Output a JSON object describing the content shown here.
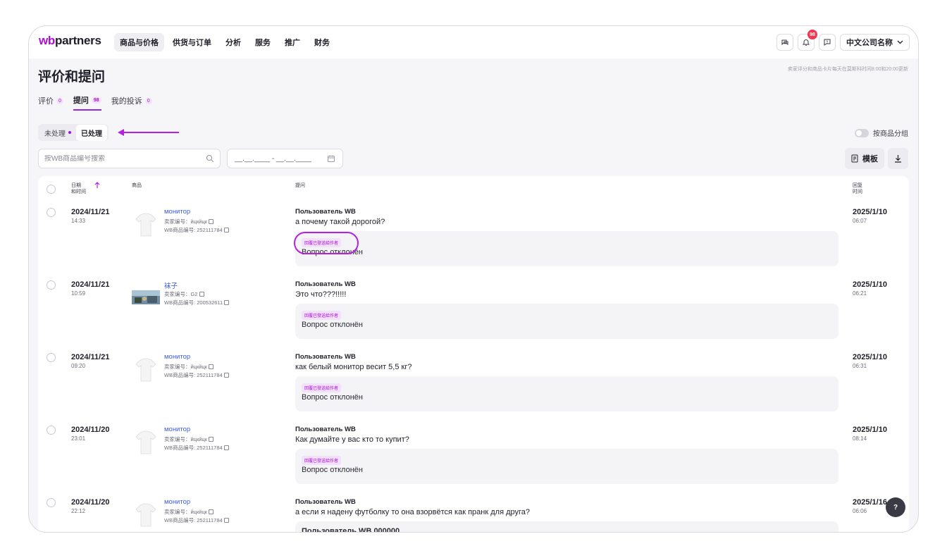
{
  "app": {
    "logo_wb": "wb",
    "logo_rest": "partners",
    "nav": [
      "商品与价格",
      "供货与订单",
      "分析",
      "服务",
      "推广",
      "财务"
    ],
    "notifications_count": "98",
    "company_name": "中文公司名称",
    "accent_color": "#b10bde"
  },
  "page": {
    "title": "评价和提问",
    "update_note": "卖家评分和商品卡片每天在莫斯科时间8:00和20:00更新",
    "tabs": [
      {
        "label": "评价",
        "count": "0"
      },
      {
        "label": "提问",
        "count": "98"
      },
      {
        "label": "我的投诉",
        "count": "0"
      }
    ],
    "status_segments": {
      "unprocessed": "未处理",
      "processed": "已处理"
    },
    "group_by_label": "按商品分组",
    "search_placeholder": "按WB商品编号搜索",
    "date_range_placeholder": "__.__.____ - __.__.____",
    "template_button": "模板"
  },
  "table": {
    "headers": {
      "date_line1": "日期",
      "date_line2": "和时间",
      "product": "商品",
      "question": "提问",
      "reply_line1": "回复",
      "reply_line2": "时间"
    },
    "rows": [
      {
        "date": "2024/11/21",
        "time": "14:33",
        "product_name": "монитор",
        "sku": "卖家编号：йцкйцк",
        "wb_id": "WB商品编号: 252111784",
        "thumb": "tshirt",
        "author": "Пользователь WB",
        "question": "а почему такой дорогой?",
        "status_badge": "回覆已發送給作者",
        "answer": "Вопрос отклонён",
        "reply_date": "2025/1/10",
        "reply_time": "06:07"
      },
      {
        "date": "2024/11/21",
        "time": "10:59",
        "product_name": "袜子",
        "sku": "卖家编号：G2",
        "wb_id": "WB商品编号: 200532611",
        "thumb": "photo",
        "author": "Пользователь WB",
        "question": "Это что???!!!!!",
        "status_badge": "回覆已發送給作者",
        "answer": "Вопрос отклонён",
        "reply_date": "2025/1/10",
        "reply_time": "06:21"
      },
      {
        "date": "2024/11/21",
        "time": "09:20",
        "product_name": "монитор",
        "sku": "卖家编号：йцкйцк",
        "wb_id": "WB商品编号: 252111784",
        "thumb": "tshirt",
        "author": "Пользователь WB",
        "question": "как белый монитор весит 5,5 кг?",
        "status_badge": "回覆已發送給作者",
        "answer": "Вопрос отклонён",
        "reply_date": "2025/1/10",
        "reply_time": "06:31"
      },
      {
        "date": "2024/11/20",
        "time": "23:01",
        "product_name": "монитор",
        "sku": "卖家编号：йцкйцк",
        "wb_id": "WB商品编号: 252111784",
        "thumb": "tshirt",
        "author": "Пользователь WB",
        "question": "Как думайте у вас кто то купит?",
        "status_badge": "回覆已發送給作者",
        "answer": "Вопрос отклонён",
        "reply_date": "2025/1/10",
        "reply_time": "08:14"
      },
      {
        "date": "2024/11/20",
        "time": "22:12",
        "product_name": "монитор",
        "sku": "卖家编号：йцкйцк",
        "wb_id": "WB商品编号: 252111784",
        "thumb": "tshirt",
        "author": "Пользователь WB",
        "question": "а если я надену футболку то она взорвётся как пранк для друга?",
        "status_badge": "",
        "answer": "Пользователь WB 000000",
        "reply_date": "2025/1/16",
        "reply_time": "06:06"
      }
    ]
  },
  "help_label": "?"
}
